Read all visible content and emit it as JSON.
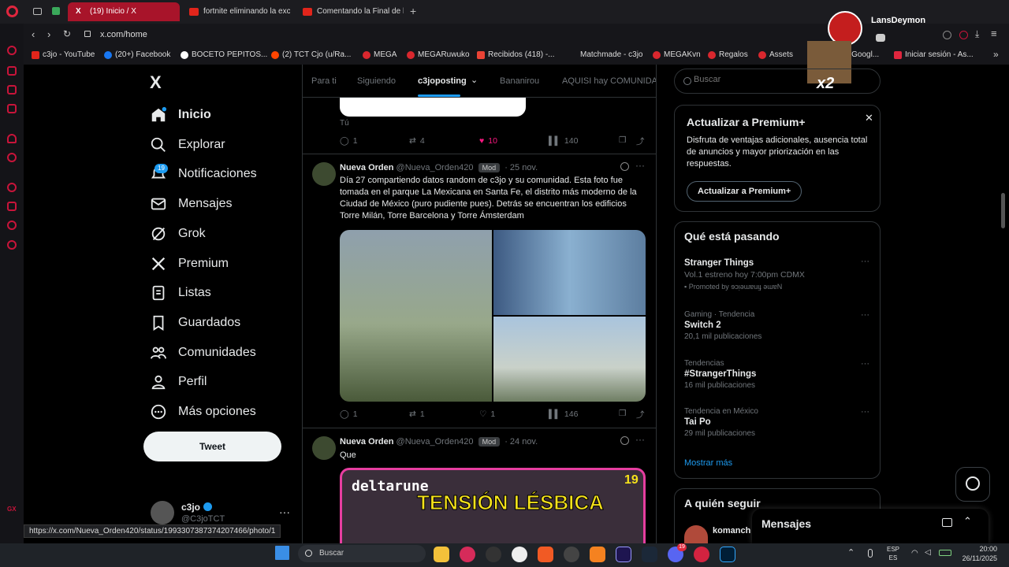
{
  "browser": {
    "tabs": [
      {
        "label": "(19) Inicio / X"
      },
      {
        "label": "fortnite eliminando la exc"
      },
      {
        "label": "Comentando la Final de la"
      }
    ],
    "url": "x.com/home",
    "status_url": "https://x.com/Nueva_Orden420/status/1993307387374207466/photo/1"
  },
  "bookmarks": [
    "c3jo - YouTube",
    "(20+) Facebook",
    "BOCETO PEPITOS...",
    "(2) TCT Cjo (u/Ra...",
    "MEGA",
    "MEGARuwuko",
    "Recibidos (418) -...",
    "Matchmade - c3jo",
    "MEGAKvn",
    "Regalos",
    "Assets",
    "- Googl...",
    "Iniciar sesión - As..."
  ],
  "overlay": {
    "user": "LansDeymon",
    "badge": "x2"
  },
  "nav": {
    "items": [
      {
        "label": "Inicio"
      },
      {
        "label": "Explorar"
      },
      {
        "label": "Notificaciones",
        "badge": "19"
      },
      {
        "label": "Mensajes"
      },
      {
        "label": "Grok"
      },
      {
        "label": "Premium"
      },
      {
        "label": "Listas"
      },
      {
        "label": "Guardados"
      },
      {
        "label": "Comunidades"
      },
      {
        "label": "Perfil"
      },
      {
        "label": "Más opciones"
      }
    ],
    "tweet_button": "Tweet",
    "account": {
      "name": "c3jo",
      "handle": "@C3joTCT"
    }
  },
  "feed": {
    "tabs": [
      "Para ti",
      "Siguiendo",
      "c3joposting",
      "Bananirou",
      "AQUISI hay COMUNIDA"
    ],
    "prev": {
      "reply_label": "Tú",
      "replies": "1",
      "reposts": "4",
      "likes": "10",
      "views": "140"
    },
    "posts": [
      {
        "name": "Nueva Orden",
        "handle": "@Nueva_Orden420",
        "badge": "Mod",
        "date": "· 25 nov.",
        "text": "Día 27 compartiendo datos random de c3jo y su comunidad. Esta foto fue tomada en el parque La Mexicana en Santa Fe, el distrito más moderno de la Ciudad de México (puro pudiente pues). Detrás se encuentran los edificios Torre Milán, Torre Barcelona y Torre Ámsterdam",
        "replies": "1",
        "reposts": "1",
        "likes": "1",
        "views": "146"
      },
      {
        "name": "Nueva Orden",
        "handle": "@Nueva_Orden420",
        "badge": "Mod",
        "date": "· 24 nov.",
        "text": "Que",
        "image_text": "deltarune",
        "image_title": "TENSIÓN LÉSBICA",
        "image_num": "19"
      }
    ]
  },
  "right": {
    "search_placeholder": "Buscar",
    "premium": {
      "title": "Actualizar a Premium+",
      "text": "Disfruta de ventajas adicionales, ausencia total de anuncios y mayor priorización en las respuestas.",
      "button": "Actualizar a Premium+"
    },
    "trends": {
      "title": "Qué está pasando",
      "items": [
        {
          "name": "Stranger Things",
          "meta": "Vol.1 estreno hoy 7:00pm CDMX",
          "promo": "Promoted by ɘɔᴉǝɯɐuᴉɟ ǝɯɐN"
        },
        {
          "cat": "Gaming · Tendencia",
          "name": "Switch 2",
          "meta": "20,1 mil publicaciones"
        },
        {
          "cat": "Tendencias",
          "name": "#StrangerThings",
          "meta": "16 mil publicaciones"
        },
        {
          "cat": "Tendencia en México",
          "name": "Tai Po",
          "meta": "29 mil publicaciones"
        }
      ],
      "more": "Mostrar más"
    },
    "follow": {
      "title": "A quién seguir",
      "name": "komanch"
    },
    "messages": "Mensajes"
  },
  "taskbar": {
    "search": "Buscar",
    "lang1": "ESP",
    "lang2": "ES",
    "time": "20:00",
    "date": "26/11/2025",
    "badge": "19"
  }
}
